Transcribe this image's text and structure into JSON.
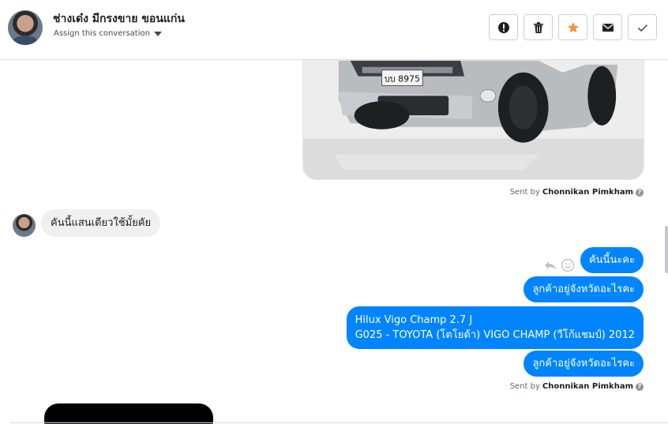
{
  "header": {
    "contact_name": "ช่างเด๋ง มีกรงขาย ขอนแก่น",
    "assign_label": "Assign this conversation"
  },
  "toolbar": {
    "buttons": [
      {
        "name": "mark-spam",
        "icon": "exclamation-icon"
      },
      {
        "name": "delete",
        "icon": "trash-icon"
      },
      {
        "name": "star",
        "icon": "star-icon",
        "color": "#f7923a"
      },
      {
        "name": "mark-unread",
        "icon": "envelope-icon"
      },
      {
        "name": "mark-done",
        "icon": "check-icon"
      }
    ]
  },
  "thread": {
    "image": {
      "plate": "บบ 8975"
    },
    "sent_by_1": {
      "prefix": "Sent by",
      "name": "Chonnikan Pimkham",
      "help": "?"
    },
    "incoming": {
      "text": "คันนี้แสนเดียวใช้มั้ยคัย"
    },
    "outgoing": [
      {
        "text": "คันนี้นะคะ"
      },
      {
        "text": "ลูกค้าอยู่จังหวัดอะไรคะ"
      },
      {
        "line1": "Hilux Vigo Champ 2.7 J",
        "line2": "G025 - TOYOTA (โตโยต้า) VIGO CHAMP (วีโก้แชมป์) 2012"
      },
      {
        "text": "ลูกค้าอยู่จังหวัดอะไรคะ"
      }
    ],
    "sent_by_2": {
      "prefix": "Sent by",
      "name": "Chonnikan Pimkham",
      "help": "?"
    }
  },
  "colors": {
    "outgoing_bubble": "#0084ff",
    "incoming_bubble": "#f0f0f0",
    "star": "#f7923a"
  }
}
